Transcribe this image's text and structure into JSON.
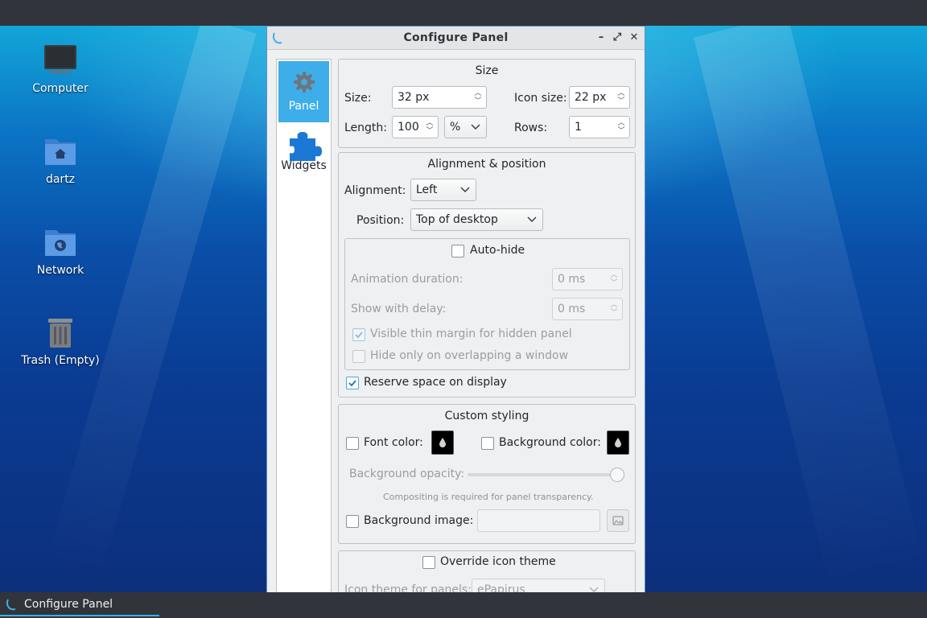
{
  "desktop": {
    "icons": [
      {
        "label": "Computer",
        "icon": "computer-icon"
      },
      {
        "label": "dartz",
        "icon": "home-folder-icon"
      },
      {
        "label": "Network",
        "icon": "network-folder-icon"
      },
      {
        "label": "Trash (Empty)",
        "icon": "trash-icon"
      }
    ]
  },
  "window": {
    "title": "Configure Panel",
    "controls": {
      "minimize": "–",
      "maximize": "⤢",
      "close": "✕"
    }
  },
  "sidebar": {
    "items": [
      {
        "label": "Panel",
        "icon": "gear-icon",
        "active": true
      },
      {
        "label": "Widgets",
        "icon": "puzzle-icon",
        "active": false
      }
    ]
  },
  "size": {
    "title": "Size",
    "size_label": "Size:",
    "size_value": "32 px",
    "icon_size_label": "Icon size:",
    "icon_size_value": "22 px",
    "length_label": "Length:",
    "length_value": "100",
    "length_unit": "%",
    "rows_label": "Rows:",
    "rows_value": "1"
  },
  "alignment": {
    "title": "Alignment & position",
    "alignment_label": "Alignment:",
    "alignment_value": "Left",
    "position_label": "Position:",
    "position_value": "Top of desktop",
    "autohide_label": "Auto-hide",
    "autohide_checked": false,
    "animation_label": "Animation duration:",
    "animation_value": "0 ms",
    "delay_label": "Show with delay:",
    "delay_value": "0 ms",
    "thin_margin_label": "Visible thin margin for hidden panel",
    "thin_margin_checked": true,
    "overlap_label": "Hide only on overlapping a window",
    "overlap_checked": false,
    "reserve_label": "Reserve space on display",
    "reserve_checked": true
  },
  "styling": {
    "title": "Custom styling",
    "font_color_label": "Font color:",
    "font_color_checked": false,
    "font_color_value": "#000000",
    "bg_color_label": "Background color:",
    "bg_color_checked": false,
    "bg_color_value": "#000000",
    "opacity_label": "Background opacity:",
    "opacity_percent": 100,
    "compositing_note": "Compositing is required for panel transparency.",
    "bg_image_label": "Background image:",
    "bg_image_checked": false
  },
  "icon_theme": {
    "override_label": "Override icon theme",
    "override_checked": false,
    "theme_label": "Icon theme for panels:",
    "theme_value": "ePapirus"
  },
  "taskbar": {
    "task_label": "Configure Panel"
  },
  "colors": {
    "accent": "#3daee9",
    "window_bg": "#eff0f1",
    "taskbar_bg": "#31343b"
  }
}
